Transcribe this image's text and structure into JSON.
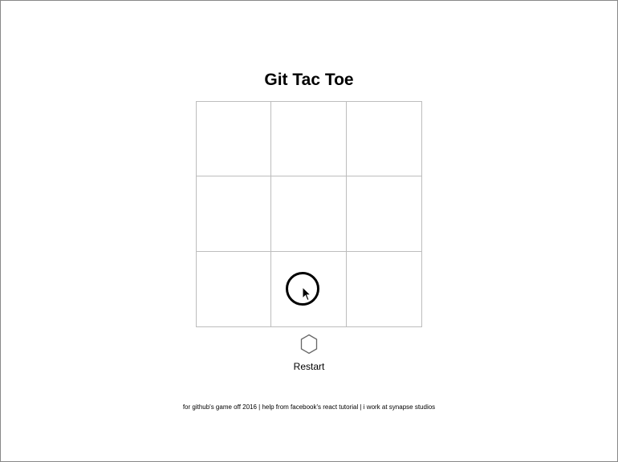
{
  "game": {
    "title": "Git Tac Toe",
    "board": {
      "rows": [
        [
          "",
          "",
          ""
        ],
        [
          "",
          "",
          ""
        ],
        [
          "",
          "O",
          ""
        ]
      ]
    },
    "current_player_icon": "hexagon-icon",
    "restart_label": "Restart"
  },
  "footer": {
    "text": "for github's game off 2016 | help from facebook's react tutorial | i work at synapse studios"
  }
}
